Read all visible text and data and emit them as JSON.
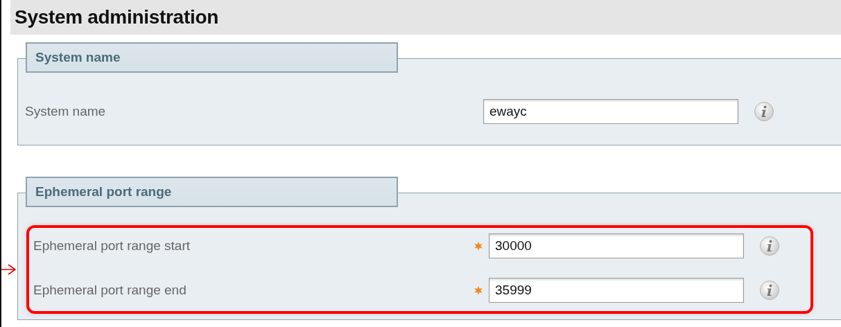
{
  "page": {
    "title": "System administration"
  },
  "sections": [
    {
      "legend": "System name",
      "highlighted": false,
      "fields": [
        {
          "label": "System name",
          "value": "ewayc",
          "required": false
        }
      ]
    },
    {
      "legend": "Ephemeral port range",
      "highlighted": true,
      "fields": [
        {
          "label": "Ephemeral port range start",
          "value": "30000",
          "required": true
        },
        {
          "label": "Ephemeral port range end",
          "value": "35999",
          "required": true
        }
      ]
    }
  ]
}
